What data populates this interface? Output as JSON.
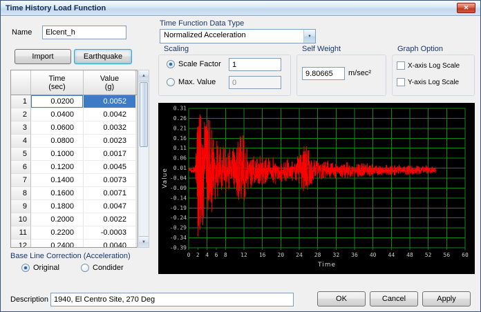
{
  "window": {
    "title": "Time History Load Function"
  },
  "icons": {
    "close": "✕",
    "scroll_up": "▲",
    "scroll_down": "▼",
    "combo_arrow": "▼"
  },
  "name_field": {
    "label": "Name",
    "value": "Elcent_h"
  },
  "actions": {
    "import": "Import",
    "earthquake": "Earthquake",
    "ok": "OK",
    "cancel": "Cancel",
    "apply": "Apply"
  },
  "table": {
    "columns": [
      "Time\n(sec)",
      "Value\n(g)"
    ],
    "selected_row": 1,
    "rows": [
      {
        "no": "1",
        "time": "0.0200",
        "value": "0.0052"
      },
      {
        "no": "2",
        "time": "0.0400",
        "value": "0.0042"
      },
      {
        "no": "3",
        "time": "0.0600",
        "value": "0.0032"
      },
      {
        "no": "4",
        "time": "0.0800",
        "value": "0.0023"
      },
      {
        "no": "5",
        "time": "0.1000",
        "value": "0.0017"
      },
      {
        "no": "6",
        "time": "0.1200",
        "value": "0.0045"
      },
      {
        "no": "7",
        "time": "0.1400",
        "value": "0.0073"
      },
      {
        "no": "8",
        "time": "0.1600",
        "value": "0.0071"
      },
      {
        "no": "9",
        "time": "0.1800",
        "value": "0.0047"
      },
      {
        "no": "10",
        "time": "0.2000",
        "value": "0.0022"
      },
      {
        "no": "11",
        "time": "0.2200",
        "value": "-0.0003"
      },
      {
        "no": "12",
        "time": "0.2400",
        "value": "0.0040"
      }
    ]
  },
  "baseline": {
    "label": "Base Line Correction (Acceleration)",
    "original": {
      "label": "Original",
      "selected": true
    },
    "condider": {
      "label": "Condider",
      "selected": false
    }
  },
  "data_type": {
    "label": "Time Function Data Type",
    "value": "Normalized Acceleration"
  },
  "scaling": {
    "label": "Scaling",
    "scale_factor": {
      "label": "Scale Factor",
      "value": "1",
      "selected": true
    },
    "max_value": {
      "label": "Max. Value",
      "value": "0",
      "selected": false
    }
  },
  "self_weight": {
    "label": "Self Weight",
    "value": "9.80665",
    "unit": "m/sec²"
  },
  "graph_option": {
    "label": "Graph Option",
    "x_log": {
      "label": "X-axis Log Scale",
      "checked": false
    },
    "y_log": {
      "label": "Y-axis Log Scale",
      "checked": false
    }
  },
  "description": {
    "label": "Description",
    "value": "1940, El Centro Site, 270 Deg"
  },
  "chart_data": {
    "type": "line",
    "xlabel": "Time",
    "ylabel": "Value",
    "x_range": [
      0,
      60
    ],
    "y_range": [
      -0.39,
      0.31
    ],
    "y_ticks": [
      0.31,
      0.26,
      0.21,
      0.16,
      0.11,
      0.06,
      0.01,
      -0.04,
      -0.09,
      -0.14,
      -0.19,
      -0.24,
      -0.29,
      -0.34,
      -0.39
    ],
    "x_tick_labels": [
      "0",
      "2",
      "4",
      "6",
      "8",
      "12",
      "16",
      "20",
      "24",
      "28",
      "32",
      "36",
      "40",
      "44",
      "48",
      "52",
      "56",
      "60"
    ],
    "x_grid_step": 4,
    "background": "#000000",
    "grid_color": "#0b8a0b",
    "signal_color": "#ff0000",
    "label_color": "#c8c8c8",
    "end_time": 53.6,
    "dt": 0.04,
    "seed": 20,
    "envelope": [
      [
        0,
        0.006
      ],
      [
        1.4,
        0.02
      ],
      [
        1.8,
        0.12
      ],
      [
        2,
        0.3
      ],
      [
        2.6,
        0.28
      ],
      [
        3.5,
        0.2
      ],
      [
        4.5,
        0.21
      ],
      [
        5.5,
        0.16
      ],
      [
        6.5,
        0.11
      ],
      [
        8,
        0.1
      ],
      [
        10,
        0.08
      ],
      [
        11,
        0.14
      ],
      [
        12,
        0.13
      ],
      [
        13,
        0.08
      ],
      [
        15,
        0.06
      ],
      [
        17,
        0.06
      ],
      [
        20,
        0.05
      ],
      [
        23,
        0.04
      ],
      [
        25,
        0.09
      ],
      [
        26,
        0.1
      ],
      [
        27,
        0.05
      ],
      [
        29,
        0.04
      ],
      [
        32,
        0.035
      ],
      [
        35,
        0.03
      ],
      [
        38,
        0.028
      ],
      [
        42,
        0.022
      ],
      [
        46,
        0.02
      ],
      [
        50,
        0.018
      ],
      [
        52,
        0.02
      ],
      [
        53.6,
        0.012
      ]
    ],
    "forced_peaks": [
      [
        2,
        -0.335
      ],
      [
        2.08,
        0.22
      ],
      [
        2.16,
        -0.28
      ],
      [
        2.3,
        0.26
      ],
      [
        2.44,
        -0.3
      ],
      [
        2.6,
        0.27
      ],
      [
        3.2,
        -0.24
      ],
      [
        3.6,
        0.22
      ],
      [
        4.2,
        -0.2
      ],
      [
        4.6,
        0.25
      ],
      [
        5,
        -0.21
      ],
      [
        11.2,
        0.17
      ],
      [
        11.4,
        -0.14
      ],
      [
        12,
        0.15
      ],
      [
        25.6,
        0.12
      ],
      [
        25.8,
        -0.1
      ]
    ]
  }
}
